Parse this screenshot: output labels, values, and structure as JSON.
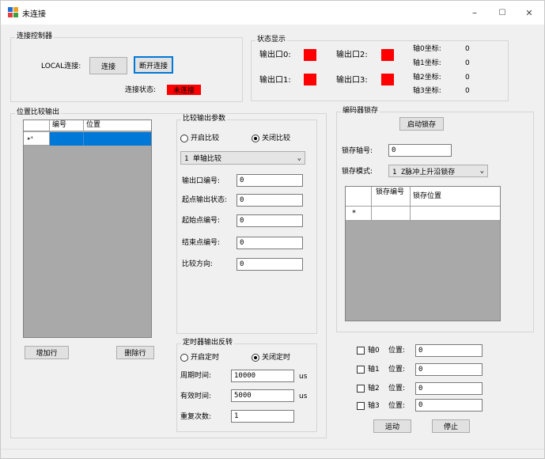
{
  "window": {
    "title": "未连接",
    "minimize": "–",
    "maximize": "☐",
    "close": "✕"
  },
  "connect_group": {
    "title": "连接控制器",
    "local_label": "LOCAL连接:",
    "connect_btn": "连接",
    "disconnect_btn": "断开连接",
    "status_label": "连接状态:",
    "status_value": "未连接"
  },
  "status_group": {
    "title": "状态显示",
    "out0": "输出口0:",
    "out1": "输出口1:",
    "out2": "输出口2:",
    "out3": "输出口3:",
    "axis0": "轴0坐标:",
    "axis1": "轴1坐标:",
    "axis2": "轴2坐标:",
    "axis3": "轴3坐标:",
    "axis0_val": "0",
    "axis1_val": "0",
    "axis2_val": "0",
    "axis3_val": "0",
    "indicator_color": "#ff0000"
  },
  "compare_out": {
    "title": "位置比较输出",
    "col_num": "编号",
    "col_pos": "位置",
    "row_marker": "▸*",
    "add_row": "增加行",
    "del_row": "删除行"
  },
  "compare_params": {
    "title": "比较输出参数",
    "open_cmp": "开启比较",
    "close_cmp": "关闭比较",
    "mode_value": "1 单轴比较",
    "out_num_label": "输出口编号:",
    "start_state_label": "起点输出状态:",
    "start_num_label": "起始点编号:",
    "end_num_label": "结束点编号:",
    "dir_label": "比较方向:",
    "out_num": "0",
    "start_state": "0",
    "start_num": "0",
    "end_num": "0",
    "dir": "0"
  },
  "timer": {
    "title": "定时器输出反转",
    "open_timer": "开启定时",
    "close_timer": "关闭定时",
    "period_label": "周期时间:",
    "valid_label": "有效时间:",
    "repeat_label": "重复次数:",
    "period": "10000",
    "valid": "5000",
    "repeat": "1",
    "unit": "us"
  },
  "encoder": {
    "title": "编码器锁存",
    "start_btn": "启动锁存",
    "axis_label": "锁存轴号:",
    "axis_value": "0",
    "mode_label": "锁存模式:",
    "mode_value": "1 Z脉冲上升沿锁存",
    "col_num": "锁存编号",
    "col_pos": "锁存位置",
    "row_marker": "*"
  },
  "axes": [
    {
      "label": "轴0",
      "pos_label": "位置:",
      "value": "0"
    },
    {
      "label": "轴1",
      "pos_label": "位置:",
      "value": "0"
    },
    {
      "label": "轴2",
      "pos_label": "位置:",
      "value": "0"
    },
    {
      "label": "轴3",
      "pos_label": "位置:",
      "value": "0"
    }
  ],
  "motion": {
    "run": "运动",
    "stop": "停止"
  }
}
